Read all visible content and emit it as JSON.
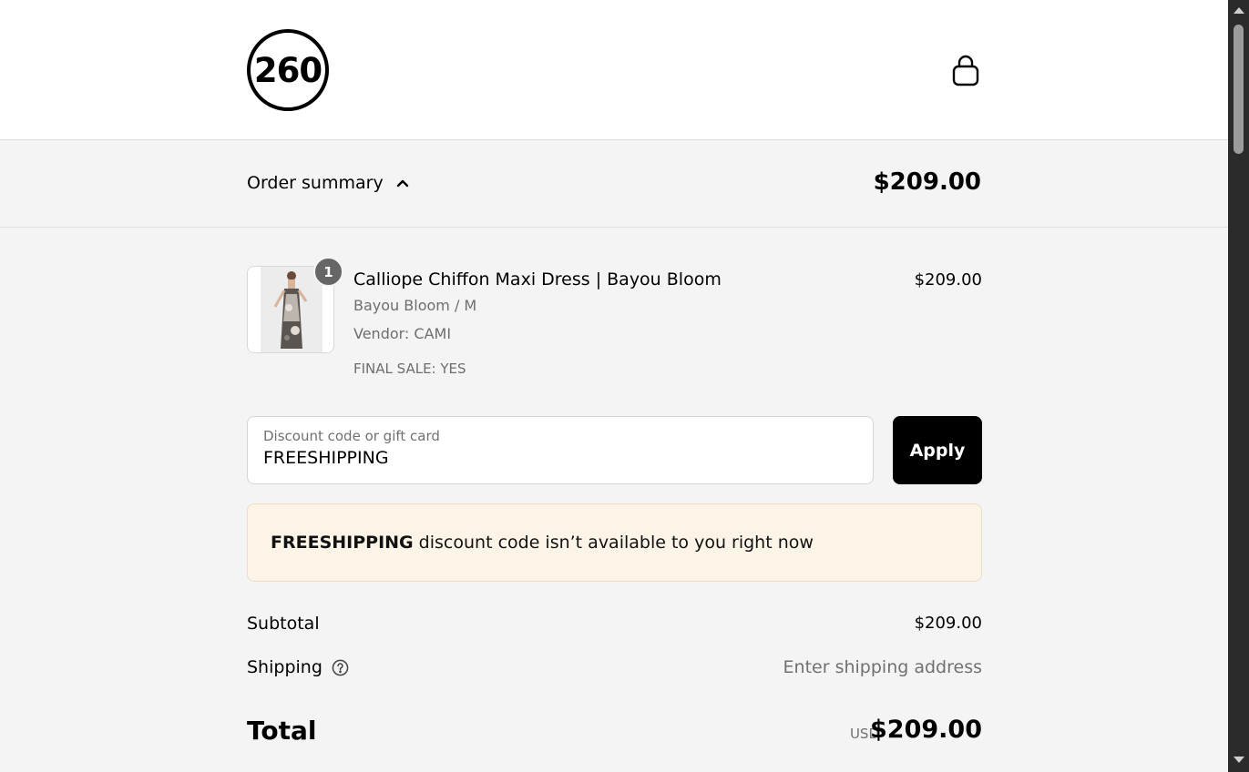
{
  "header": {
    "logo_text": "260",
    "cart_icon": "shopping-bag-icon"
  },
  "summary_bar": {
    "toggle_label": "Order summary",
    "toggle_icon": "chevron-up-icon",
    "total": "$209.00"
  },
  "product": {
    "quantity": "1",
    "name": "Calliope Chiffon Maxi Dress | Bayou Bloom",
    "variant": "Bayou Bloom / M",
    "vendor": "Vendor: CAMI",
    "final_sale": "FINAL SALE: YES",
    "price": "$209.00"
  },
  "discount": {
    "label": "Discount code or gift card",
    "value": "FREESHIPPING",
    "apply_label": "Apply"
  },
  "notice": {
    "code": "FREESHIPPING",
    "message": " discount code isn’t available to you right now"
  },
  "totals": {
    "subtotal_label": "Subtotal",
    "subtotal_value": "$209.00",
    "shipping_label": "Shipping",
    "shipping_help_icon": "question-circle-icon",
    "shipping_value": "Enter shipping address",
    "total_label": "Total",
    "total_currency": "USD",
    "total_value": "$209.00"
  },
  "colors": {
    "apply_button": "#000000",
    "notice_background": "#fdf4e8",
    "page_background": "#f4f4f4"
  }
}
